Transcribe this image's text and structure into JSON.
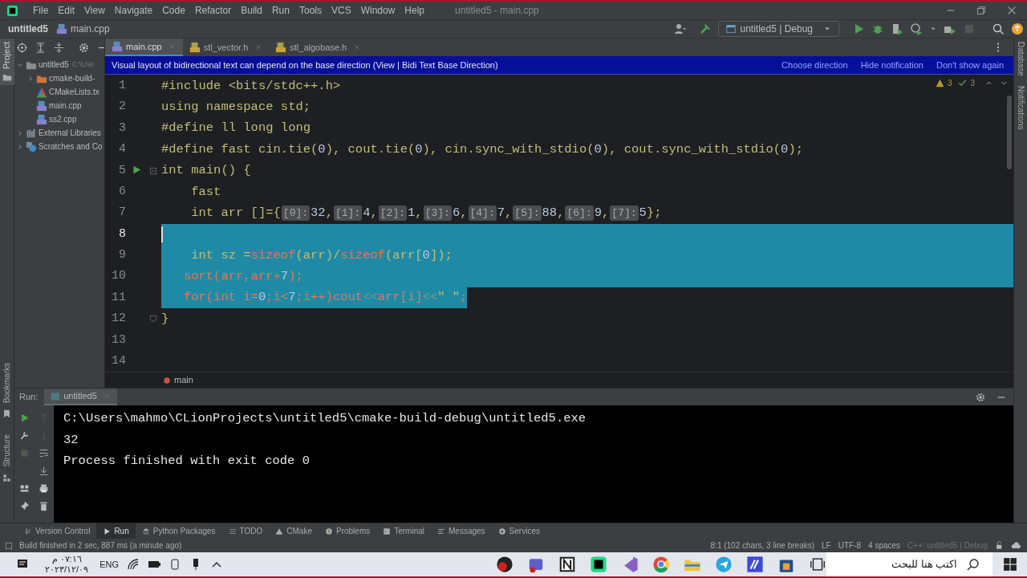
{
  "menu": {
    "items": [
      "File",
      "Edit",
      "View",
      "Navigate",
      "Code",
      "Refactor",
      "Build",
      "Run",
      "Tools",
      "VCS",
      "Window",
      "Help"
    ],
    "title": "untitled5 - main.cpp"
  },
  "navbar": {
    "project": "untitled5",
    "file": "main.cpp",
    "run_config": "untitled5 | Debug"
  },
  "side_labels": {
    "left_top": "Project",
    "left_middle": "Bookmarks",
    "left_bottom": "Structure",
    "right_top": "Database",
    "right_bottom": "Notifications"
  },
  "project_tree": [
    {
      "label": "untitled5",
      "note": "C:\\Use",
      "kind": "folder",
      "expanded": true,
      "selected": false,
      "children": [
        {
          "label": "cmake-build-",
          "kind": "build",
          "expanded": false,
          "selected": false
        },
        {
          "label": "CMakeLists.tx",
          "kind": "cmake",
          "selected": false
        },
        {
          "label": "main.cpp",
          "kind": "cpp",
          "selected": false
        },
        {
          "label": "ss2.cpp",
          "kind": "cpp",
          "selected": false
        }
      ]
    },
    {
      "label": "External Libraries",
      "kind": "library",
      "expanded": false,
      "selected": false
    },
    {
      "label": "Scratches and Co",
      "kind": "scratch",
      "expanded": false,
      "selected": false
    }
  ],
  "editor": {
    "tabs": [
      {
        "label": "main.cpp",
        "kind": "cpp",
        "selected": true
      },
      {
        "label": "stl_vector.h",
        "kind": "header",
        "selected": false
      },
      {
        "label": "stl_algobase.h",
        "kind": "header",
        "selected": false
      }
    ],
    "notification": {
      "message": "Visual layout of bidirectional text can depend on the base direction (View | Bidi Text Base Direction)",
      "actions": [
        "Choose direction",
        "Hide notification",
        "Don't show again"
      ]
    },
    "inspections": {
      "warnings": "3",
      "weak_warnings": "3"
    },
    "lines": [
      {
        "number": "1",
        "current": false,
        "runnable": false,
        "kind": "code",
        "selected": false,
        "tokens": [
          {
            "text": "#include <bits/stdc++.h>",
            "kind": "c"
          }
        ]
      },
      {
        "number": "2",
        "current": false,
        "runnable": false,
        "kind": "code",
        "selected": false,
        "tokens": [
          {
            "text": "using namespace std;",
            "kind": "c"
          }
        ]
      },
      {
        "number": "3",
        "current": false,
        "runnable": false,
        "kind": "code",
        "selected": false,
        "tokens": [
          {
            "text": "#define ll long long",
            "kind": "c"
          }
        ]
      },
      {
        "number": "4",
        "current": false,
        "runnable": false,
        "kind": "code",
        "selected": false,
        "tokens": [
          {
            "text": "#define fast cin.tie(",
            "kind": "c"
          },
          {
            "text": "0",
            "kind": "n"
          },
          {
            "text": "), cout.tie(",
            "kind": "c"
          },
          {
            "text": "0",
            "kind": "n"
          },
          {
            "text": "), cin.sync_with_stdio(",
            "kind": "c"
          },
          {
            "text": "0",
            "kind": "n"
          },
          {
            "text": "), cout.sync_with_stdio(",
            "kind": "c"
          },
          {
            "text": "0",
            "kind": "n"
          },
          {
            "text": ");",
            "kind": "c"
          }
        ]
      },
      {
        "number": "5",
        "current": false,
        "runnable": true,
        "kind": "open",
        "selected": false,
        "tokens": [
          {
            "text": "int main() {",
            "kind": "c"
          }
        ]
      },
      {
        "number": "6",
        "current": false,
        "runnable": false,
        "kind": "code",
        "selected": false,
        "tokens": [
          {
            "text": "    fast",
            "kind": "c"
          }
        ]
      },
      {
        "number": "7",
        "current": false,
        "runnable": false,
        "kind": "code",
        "selected": false,
        "tokens": [
          {
            "text": "    int arr []={",
            "kind": "c"
          },
          {
            "text": "[0]:",
            "kind": "h"
          },
          {
            "text": "32",
            "kind": "n"
          },
          {
            "text": ",",
            "kind": "c"
          },
          {
            "text": "[1]:",
            "kind": "h"
          },
          {
            "text": "4",
            "kind": "n"
          },
          {
            "text": ",",
            "kind": "c"
          },
          {
            "text": "[2]:",
            "kind": "h"
          },
          {
            "text": "1",
            "kind": "n"
          },
          {
            "text": ",",
            "kind": "c"
          },
          {
            "text": "[3]:",
            "kind": "h"
          },
          {
            "text": "6",
            "kind": "n"
          },
          {
            "text": ",",
            "kind": "c"
          },
          {
            "text": "[4]:",
            "kind": "h"
          },
          {
            "text": "7",
            "kind": "n"
          },
          {
            "text": ",",
            "kind": "c"
          },
          {
            "text": "[5]:",
            "kind": "h"
          },
          {
            "text": "88",
            "kind": "n"
          },
          {
            "text": ",",
            "kind": "c"
          },
          {
            "text": "[6]:",
            "kind": "h"
          },
          {
            "text": "9",
            "kind": "n"
          },
          {
            "text": ",",
            "kind": "c"
          },
          {
            "text": "[7]:",
            "kind": "h"
          },
          {
            "text": "5",
            "kind": "n"
          },
          {
            "text": "};",
            "kind": "c"
          }
        ]
      },
      {
        "number": "8",
        "current": true,
        "runnable": false,
        "kind": "code",
        "selected": true,
        "full_width": true
      },
      {
        "number": "9",
        "current": false,
        "runnable": false,
        "kind": "code",
        "selected": true,
        "full_width": true,
        "tokens": [
          {
            "text": "    int sz =",
            "kind": "c"
          },
          {
            "text": "sizeof",
            "kind": "f"
          },
          {
            "text": "(arr)/",
            "kind": "c"
          },
          {
            "text": "sizeof",
            "kind": "f"
          },
          {
            "text": "(arr[",
            "kind": "c"
          },
          {
            "text": "0",
            "kind": "n"
          },
          {
            "text": "]);",
            "kind": "c"
          }
        ]
      },
      {
        "number": "10",
        "current": false,
        "runnable": false,
        "kind": "code",
        "selected": true,
        "full_width": true,
        "tokens": [
          {
            "text": "   sort(arr,arr+",
            "kind": "f"
          },
          {
            "text": "7",
            "kind": "n"
          },
          {
            "text": ");",
            "kind": "f"
          }
        ]
      },
      {
        "number": "11",
        "current": false,
        "runnable": false,
        "kind": "code",
        "selected": true,
        "full_width": false,
        "tokens": [
          {
            "text": "   for(int i=",
            "kind": "f"
          },
          {
            "text": "0",
            "kind": "n"
          },
          {
            "text": ";i<",
            "kind": "f"
          },
          {
            "text": "7",
            "kind": "n"
          },
          {
            "text": ";i++)cout",
            "kind": "f"
          },
          {
            "text": "<<",
            "kind": "op"
          },
          {
            "text": "arr[i]",
            "kind": "f"
          },
          {
            "text": "<<",
            "kind": "op"
          },
          {
            "text": "\" \"",
            "kind": "s"
          },
          {
            "text": ";",
            "kind": "f"
          }
        ]
      },
      {
        "number": "12",
        "current": false,
        "runnable": false,
        "kind": "close",
        "selected": false,
        "tokens": [
          {
            "text": "}",
            "kind": "c"
          }
        ]
      },
      {
        "number": "13",
        "current": false,
        "runnable": false,
        "kind": "code",
        "selected": false
      },
      {
        "number": "14",
        "current": false,
        "runnable": false,
        "kind": "code",
        "selected": false
      }
    ],
    "breadcrumb": "main"
  },
  "run_panel": {
    "label": "Run:",
    "tab": "untitled5",
    "output": [
      "C:\\Users\\mahmo\\CLionProjects\\untitled5\\cmake-build-debug\\untitled5.exe",
      "32",
      "Process finished with exit code 0"
    ]
  },
  "tool_tabs": [
    {
      "label": "Version Control",
      "kind": "branch",
      "selected": false
    },
    {
      "label": "Run",
      "kind": "run",
      "selected": true
    },
    {
      "label": "Python Packages",
      "kind": "layers",
      "selected": false
    },
    {
      "label": "TODO",
      "kind": "list",
      "selected": false
    },
    {
      "label": "CMake",
      "kind": "triangle",
      "selected": false
    },
    {
      "label": "Problems",
      "kind": "info",
      "selected": false
    },
    {
      "label": "Terminal",
      "kind": "terminal",
      "selected": false
    },
    {
      "label": "Messages",
      "kind": "lines",
      "selected": false
    },
    {
      "label": "Services",
      "kind": "play",
      "selected": false
    }
  ],
  "status_bar": {
    "message": "Build finished in 2 sec, 887 ms (a minute ago)",
    "position": "8:1 (102 chars, 3 line breaks)",
    "line_separator": "LF",
    "encoding": "UTF-8",
    "indent": "4 spaces",
    "context": "C++: untitled5 | Debug"
  },
  "taskbar": {
    "search_placeholder": "اكتب هنا للبحث",
    "language": "ENG",
    "time": "٠٧:١٦ م",
    "date": "٢٠٢٣/١٢/٠٩"
  }
}
